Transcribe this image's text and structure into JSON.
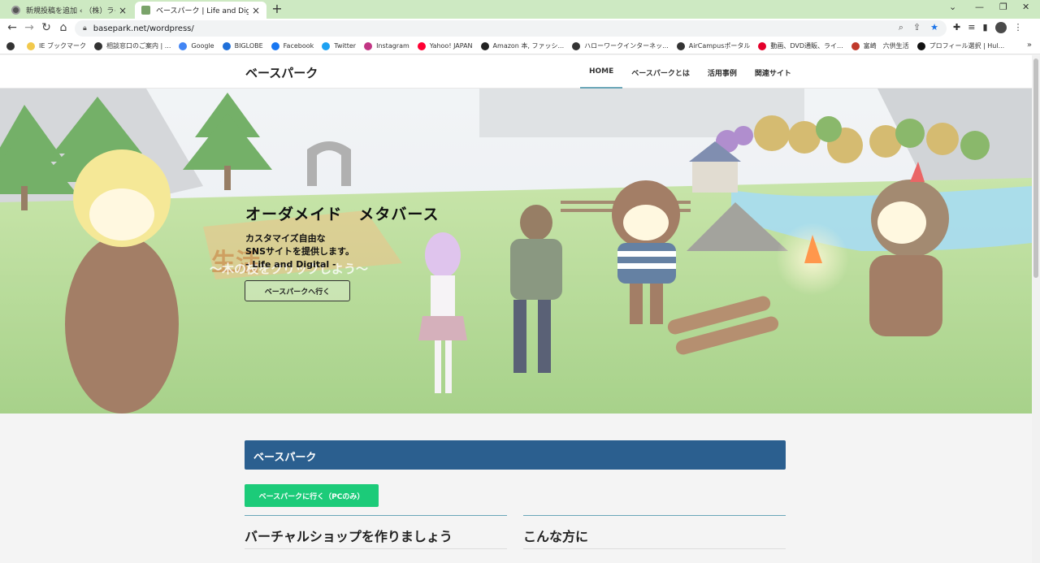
{
  "browser": {
    "tabs": [
      {
        "title": "新規投稿を追加 ‹ （株）ライフプラ",
        "active": false
      },
      {
        "title": "ベースパーク | Life and Digital",
        "active": true
      }
    ],
    "url": "basepark.net/wordpress/",
    "bookmarks": [
      {
        "label": "IE ブックマーク",
        "color": "#f2c94c"
      },
      {
        "label": "相談窓口のご案内 | ...",
        "color": "#333333"
      },
      {
        "label": "Google",
        "color": "#4285f4"
      },
      {
        "label": "BIGLOBE",
        "color": "#1e6fd9"
      },
      {
        "label": "Facebook",
        "color": "#1877f2"
      },
      {
        "label": "Twitter",
        "color": "#1da1f2"
      },
      {
        "label": "Instagram",
        "color": "#c13584"
      },
      {
        "label": "Yahoo! JAPAN",
        "color": "#ff0033"
      },
      {
        "label": "Amazon 本, ファッシ...",
        "color": "#222222"
      },
      {
        "label": "ハローワークインターネッ...",
        "color": "#333333"
      },
      {
        "label": "AirCampusポータル",
        "color": "#333333"
      },
      {
        "label": "動画、DVD通販、ライ...",
        "color": "#e4002b"
      },
      {
        "label": "富崎　六供生活",
        "color": "#c0392b"
      },
      {
        "label": "プロフィール選択 | Hul...",
        "color": "#111111"
      }
    ]
  },
  "site": {
    "title": "ベースパーク",
    "nav": [
      "HOME",
      "ベースパークとは",
      "活用事例",
      "関連サイト"
    ]
  },
  "hero": {
    "title": "オーダメイド　メタバース",
    "subtitle_lines": [
      "カスタマイズ自由な",
      "SNSサイトを提供します。",
      "- Life and Digital -"
    ],
    "button": "ベースパークへ行く",
    "sign_line1": "生活",
    "sign_line2": "〜木の枝をクリックしよう〜"
  },
  "main": {
    "section_title": "ベースパーク",
    "cta_button": "ベースパークに行く（PCのみ）",
    "col_left": "バーチャルショップを作りましょう",
    "col_right": "こんな方に"
  }
}
